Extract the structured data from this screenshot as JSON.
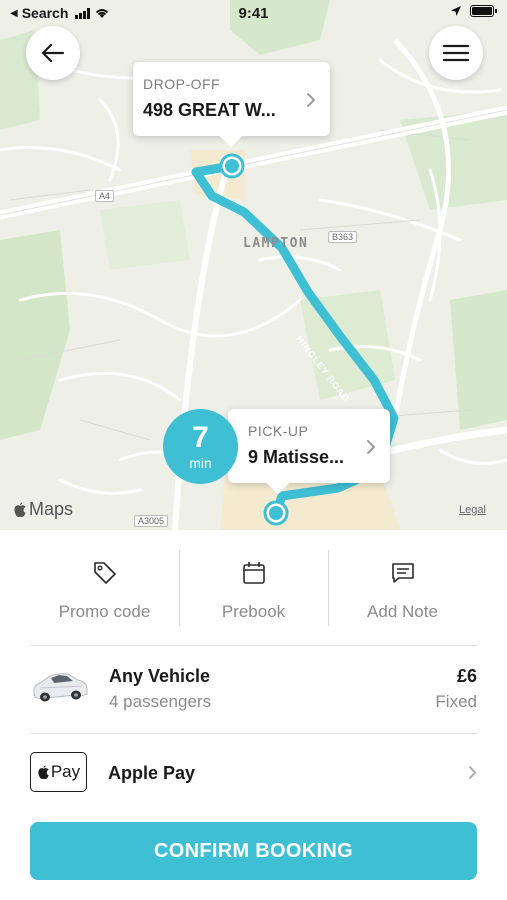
{
  "status_bar": {
    "back_app": "Search",
    "time": "9:41"
  },
  "map": {
    "area_label": "LAMPTON",
    "road_label": "HINGLEY ROAD",
    "road_badges": [
      "A4",
      "B363",
      "A3005"
    ],
    "maps_logo": "Maps",
    "legal": "Legal",
    "route_color": "#3fbfd4"
  },
  "dropoff": {
    "label": "DROP-OFF",
    "value": "498 GREAT W..."
  },
  "pickup": {
    "label": "PICK-UP",
    "value": "9 Matisse...",
    "eta_number": "7",
    "eta_unit": "min"
  },
  "options": [
    {
      "label": "Promo code",
      "icon": "tag-icon"
    },
    {
      "label": "Prebook",
      "icon": "calendar-icon"
    },
    {
      "label": "Add Note",
      "icon": "note-icon"
    }
  ],
  "vehicle": {
    "name": "Any Vehicle",
    "passengers": "4 passengers",
    "price": "£6",
    "price_type": "Fixed"
  },
  "payment": {
    "badge": "Pay",
    "name": "Apple Pay"
  },
  "confirm_label": "CONFIRM BOOKING",
  "colors": {
    "accent": "#3fbfd4",
    "muted_text": "#8a8a8a"
  }
}
